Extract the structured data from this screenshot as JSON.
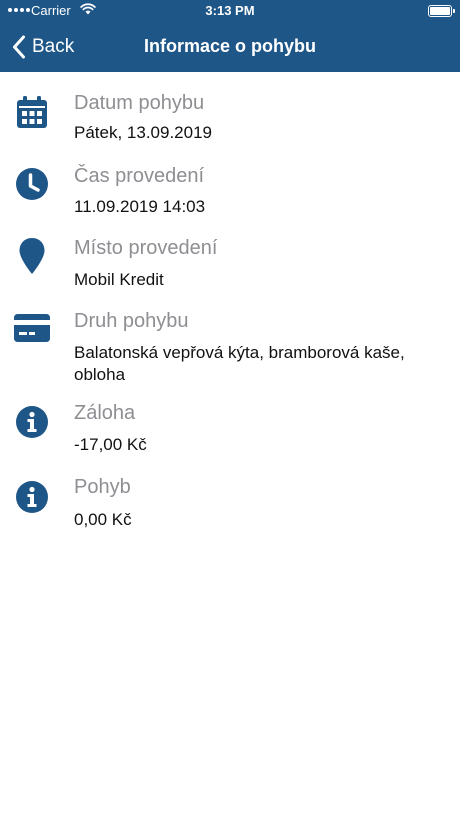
{
  "status_bar": {
    "carrier": "Carrier",
    "time": "3:13 PM"
  },
  "nav": {
    "back_label": "Back",
    "title": "Informace o pohybu"
  },
  "accent_color": "#1e5688",
  "items": [
    {
      "icon": "calendar-icon",
      "label": "Datum pohybu",
      "value": "Pátek, 13.09.2019"
    },
    {
      "icon": "clock-icon",
      "label": "Čas provedení",
      "value": "11.09.2019 14:03"
    },
    {
      "icon": "location-pin-icon",
      "label": "Místo provedení",
      "value": "Mobil Kredit"
    },
    {
      "icon": "credit-card-icon",
      "label": "Druh pohybu",
      "value": "Balatonská vepřová kýta, bramborová kaše, obloha"
    },
    {
      "icon": "info-icon",
      "label": "Záloha",
      "value": "-17,00 Kč"
    },
    {
      "icon": "info-icon",
      "label": "Pohyb",
      "value": "0,00 Kč"
    }
  ]
}
